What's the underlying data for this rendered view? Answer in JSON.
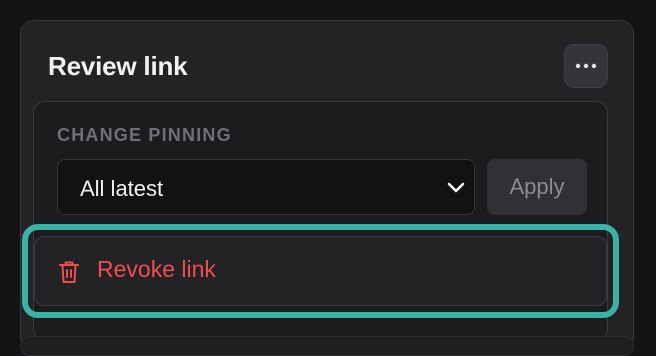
{
  "card": {
    "title": "Review link"
  },
  "more_button": {
    "icon": "ellipsis-icon"
  },
  "pinning": {
    "section_label": "CHANGE PINNING",
    "selected_option": "All latest",
    "apply_label": "Apply"
  },
  "revoke": {
    "label": "Revoke link",
    "icon": "trash-icon"
  },
  "colors": {
    "highlight": "#3ab3a6",
    "danger": "#ef4e4e"
  }
}
